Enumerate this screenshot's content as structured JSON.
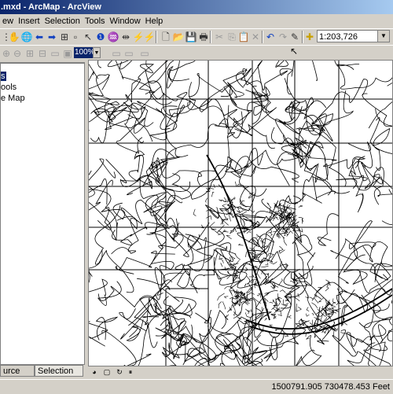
{
  "window": {
    "title": ".mxd - ArcMap - ArcView"
  },
  "menubar": {
    "items": [
      "ew",
      "Insert",
      "Selection",
      "Tools",
      "Window",
      "Help"
    ]
  },
  "toolbar": {
    "scale": "1:203,726",
    "layout_zoom": "100%"
  },
  "toc": {
    "items": [
      "s",
      "ools",
      "e Map"
    ],
    "tabs": [
      "urce",
      "Selection"
    ]
  },
  "status": {
    "coordinates": "1500791.905  730478.453 Feet"
  },
  "map": {
    "background": "#ffffff",
    "line_color": "#000000"
  },
  "icons": [
    "pan-icon",
    "globe-icon",
    "back-icon",
    "forward-icon",
    "select-icon",
    "info-icon",
    "find-icon",
    "new-icon",
    "open-icon",
    "save-icon",
    "print-icon",
    "undo-icon",
    "redo-icon",
    "add-data-icon"
  ]
}
